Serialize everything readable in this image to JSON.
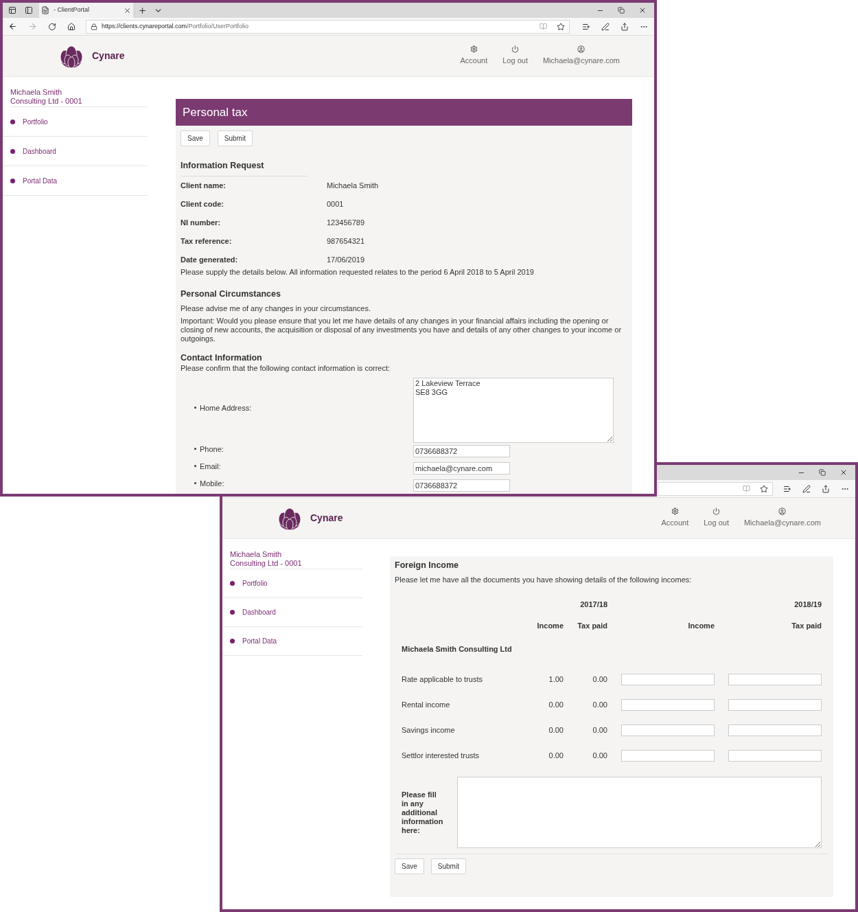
{
  "front_window": {
    "tab_title": "- ClientPortal",
    "url_host": "https://clients.cynareportal.com",
    "url_path": "/Portfolio/UserPortfolio",
    "header": {
      "brand": "Cynare",
      "nav": [
        {
          "kind": "settings",
          "label": "Account"
        },
        {
          "kind": "power",
          "label": "Log out"
        },
        {
          "kind": "user",
          "label": "Michaela@cynare.com"
        }
      ]
    },
    "sidebar": {
      "title_lines": [
        "Michaela Smith",
        "Consulting Ltd - 0001"
      ],
      "items": [
        "Portfolio",
        "Dashboard",
        "Portal Data"
      ]
    },
    "page": {
      "title": "Personal tax",
      "buttons": [
        "Save",
        "Submit"
      ],
      "heading": "Information Request",
      "fields": [
        {
          "label": "Client name:",
          "value": "Michaela Smith"
        },
        {
          "label": "Client code:",
          "value": "0001"
        },
        {
          "label": "NI number:",
          "value": "123456789"
        },
        {
          "label": "Tax reference:",
          "value": "987654321"
        },
        {
          "label": "Date generated:",
          "value": "17/06/2019"
        }
      ],
      "intro": "Please supply the details below. All information requested relates to the period 6 April 2018 to 5 April 2019",
      "circumstances": {
        "heading": "Personal Circumstances",
        "paragraphs": [
          "Please advise me of any changes in your circumstances.",
          "Important: Would you please ensure that you let me have details of any changes in your financial affairs including the opening or closing of new accounts, the acquisition or disposal of any investments you have and details of any other changes to your income or outgoings."
        ]
      },
      "contact": {
        "heading": "Contact Information",
        "intro": "Please confirm that the following contact information is correct:",
        "fields": [
          {
            "kind": "textarea",
            "label": "Home Address:",
            "value": "2 Lakeview Terrace\nSE8 3GG"
          },
          {
            "kind": "input",
            "label": "Phone:",
            "value": "0736688372"
          },
          {
            "kind": "input",
            "label": "Email:",
            "value": "michaela@cynare.com"
          },
          {
            "kind": "input",
            "label": "Mobile:",
            "value": "0736688372"
          }
        ]
      }
    }
  },
  "back_window": {
    "header": {
      "brand": "Cynare",
      "nav": [
        {
          "kind": "settings",
          "label": "Account"
        },
        {
          "kind": "power",
          "label": "Log out"
        },
        {
          "kind": "user",
          "label": "Michaela@cynare.com"
        }
      ]
    },
    "sidebar": {
      "title_lines": [
        "Michaela Smith",
        "Consulting Ltd - 0001"
      ],
      "items": [
        "Portfolio",
        "Dashboard",
        "Portal Data"
      ]
    },
    "page": {
      "heading": "Foreign Income",
      "intro": "Please let me have all the documents you have showing details of the following incomes:",
      "years": [
        "2017/18",
        "2018/19"
      ],
      "columns": [
        "Income",
        "Tax paid",
        "Income",
        "Tax paid"
      ],
      "group": "Michaela Smith Consulting Ltd",
      "rows": [
        {
          "label": "Rate applicable to trusts",
          "income": "1.00",
          "tax_paid": "0.00"
        },
        {
          "label": "Rental income",
          "income": "0.00",
          "tax_paid": "0.00"
        },
        {
          "label": "Savings income",
          "income": "0.00",
          "tax_paid": "0.00"
        },
        {
          "label": "Settlor interested trusts",
          "income": "0.00",
          "tax_paid": "0.00"
        }
      ],
      "notes_label": "Please fill in any additional information here:",
      "buttons": [
        "Save",
        "Submit"
      ]
    }
  }
}
